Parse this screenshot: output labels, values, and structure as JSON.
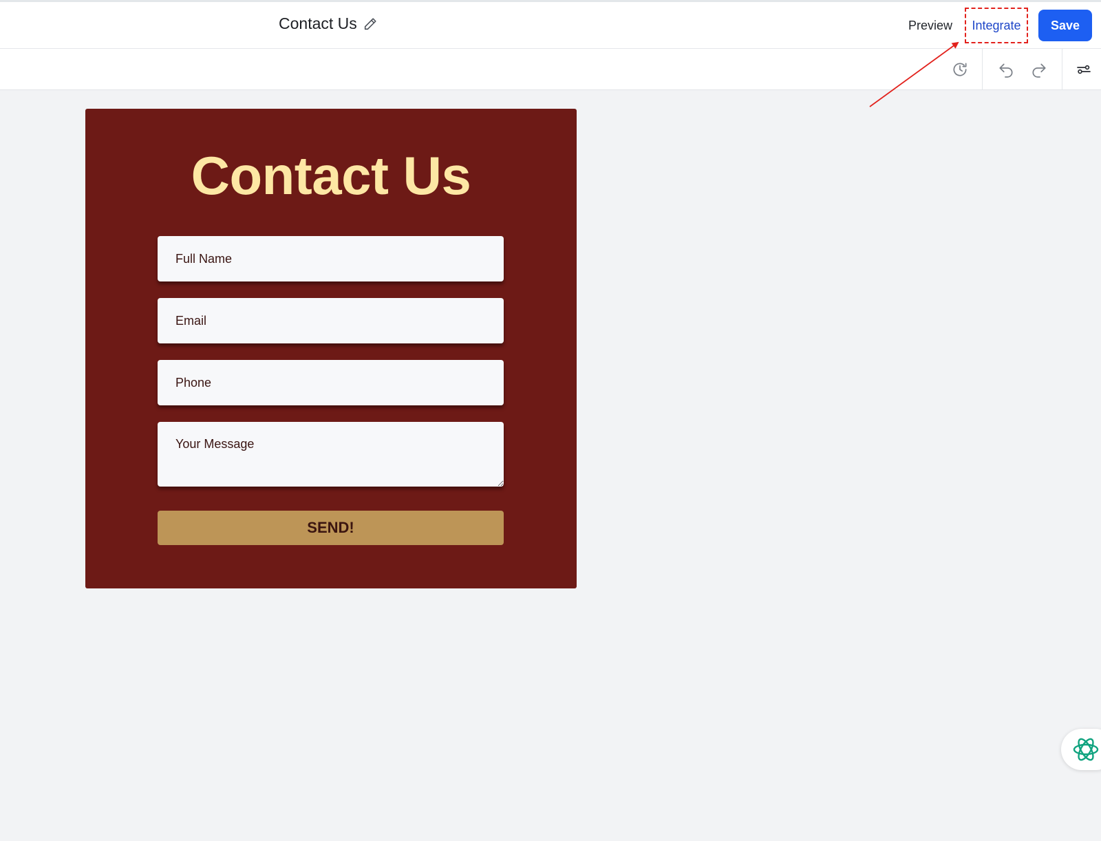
{
  "header": {
    "doc_title": "Contact Us",
    "preview_label": "Preview",
    "integrate_label": "Integrate",
    "save_label": "Save"
  },
  "toolbar": {
    "icons": [
      "history-icon",
      "undo-icon",
      "redo-icon",
      "settings-sliders-icon"
    ]
  },
  "form": {
    "title": "Contact Us",
    "full_name_placeholder": "Full Name",
    "email_placeholder": "Email",
    "phone_placeholder": "Phone",
    "message_placeholder": "Your Message",
    "submit_label": "SEND!"
  },
  "colors": {
    "card_background": "#6d1a16",
    "card_title": "#fde7a4",
    "submit_button": "#bd9557",
    "save_button": "#1d5ff2",
    "integrate_text": "#1e46c8",
    "annotation": "#e2211c",
    "ai_icon": "#10a37f"
  }
}
